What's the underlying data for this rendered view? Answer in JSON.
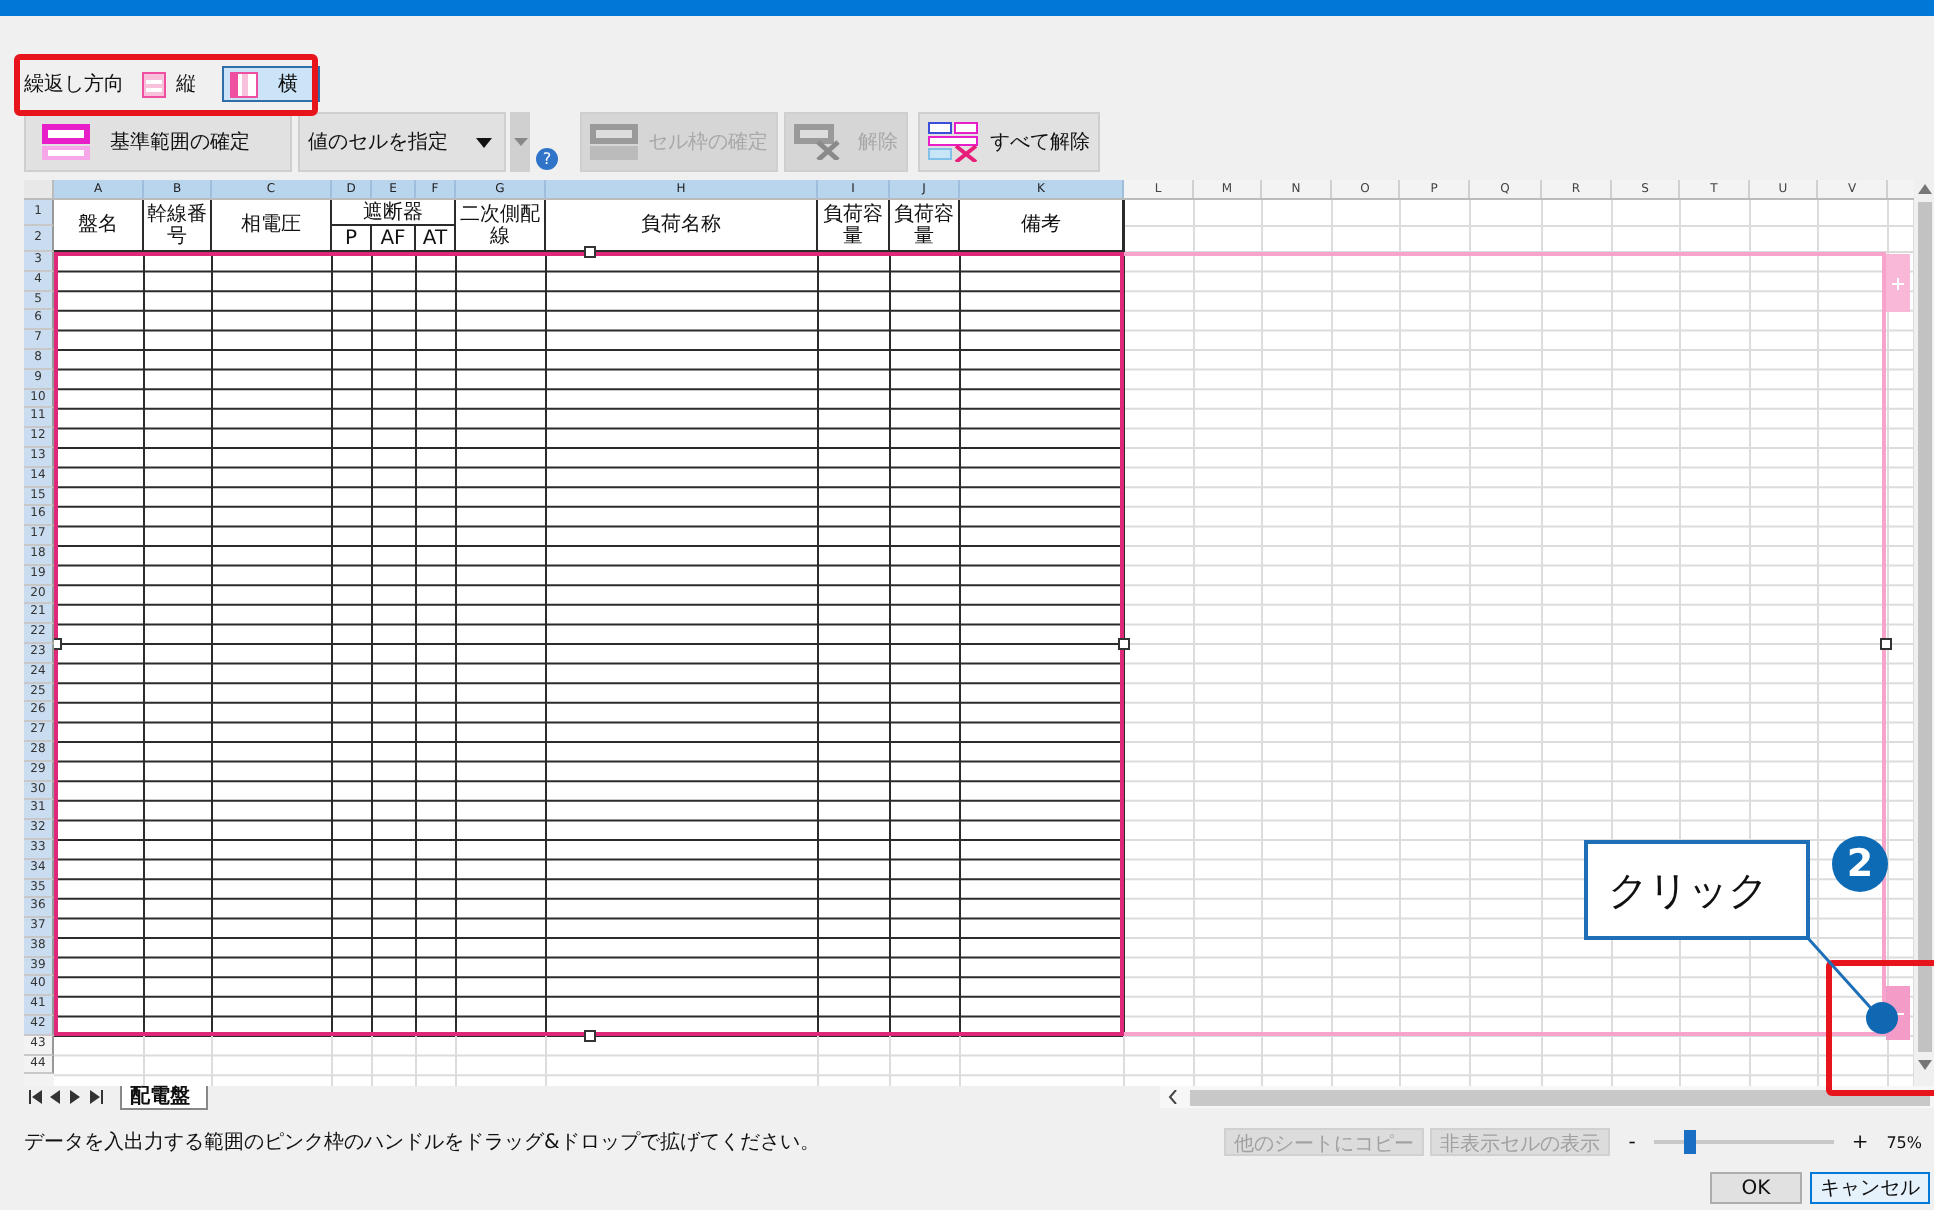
{
  "repeat_direction": {
    "label": "繰返し方向",
    "options": [
      {
        "kind": "vertical",
        "label": "縦",
        "selected": false
      },
      {
        "kind": "horizontal",
        "label": "横",
        "selected": true
      }
    ]
  },
  "toolbar": [
    {
      "kind": "range-confirm",
      "label": "基準範囲の確定",
      "disabled": false
    },
    {
      "kind": "dropdown",
      "value": "値のセルを指定"
    },
    {
      "kind": "help",
      "label": "?"
    },
    {
      "kind": "cell-confirm",
      "label": "セル枠の確定",
      "disabled": true
    },
    {
      "kind": "clear",
      "label": "解除",
      "disabled": true
    },
    {
      "kind": "clear-all",
      "label": "すべて解除",
      "disabled": false
    }
  ],
  "sheet": {
    "columns": [
      {
        "label": "A",
        "selected": true
      },
      {
        "label": "B",
        "selected": true
      },
      {
        "label": "C",
        "selected": true
      },
      {
        "label": "D",
        "selected": true
      },
      {
        "label": "E",
        "selected": true
      },
      {
        "label": "F",
        "selected": true
      },
      {
        "label": "G",
        "selected": true
      },
      {
        "label": "H",
        "selected": true
      },
      {
        "label": "I",
        "selected": true
      },
      {
        "label": "J",
        "selected": true
      },
      {
        "label": "K",
        "selected": true
      },
      {
        "label": "L",
        "selected": false
      },
      {
        "label": "M",
        "selected": false
      },
      {
        "label": "N",
        "selected": false
      },
      {
        "label": "O",
        "selected": false
      },
      {
        "label": "P",
        "selected": false
      },
      {
        "label": "Q",
        "selected": false
      },
      {
        "label": "R",
        "selected": false
      },
      {
        "label": "S",
        "selected": false
      },
      {
        "label": "T",
        "selected": false
      },
      {
        "label": "U",
        "selected": false
      },
      {
        "label": "V",
        "selected": false
      }
    ],
    "rows": [
      {
        "label": "1",
        "selected": true
      },
      {
        "label": "2",
        "selected": true
      },
      {
        "label": "3",
        "selected": true
      },
      {
        "label": "4",
        "selected": true
      },
      {
        "label": "5",
        "selected": true
      },
      {
        "label": "6",
        "selected": true
      },
      {
        "label": "7",
        "selected": true
      },
      {
        "label": "8",
        "selected": true
      },
      {
        "label": "9",
        "selected": true
      },
      {
        "label": "10",
        "selected": true
      },
      {
        "label": "11",
        "selected": true
      },
      {
        "label": "12",
        "selected": true
      },
      {
        "label": "13",
        "selected": true
      },
      {
        "label": "14",
        "selected": true
      },
      {
        "label": "15",
        "selected": true
      },
      {
        "label": "16",
        "selected": true
      },
      {
        "label": "17",
        "selected": true
      },
      {
        "label": "18",
        "selected": true
      },
      {
        "label": "19",
        "selected": true
      },
      {
        "label": "20",
        "selected": true
      },
      {
        "label": "21",
        "selected": true
      },
      {
        "label": "22",
        "selected": true
      },
      {
        "label": "23",
        "selected": true
      },
      {
        "label": "24",
        "selected": true
      },
      {
        "label": "25",
        "selected": true
      },
      {
        "label": "26",
        "selected": true
      },
      {
        "label": "27",
        "selected": true
      },
      {
        "label": "28",
        "selected": true
      },
      {
        "label": "29",
        "selected": true
      },
      {
        "label": "30",
        "selected": true
      },
      {
        "label": "31",
        "selected": true
      },
      {
        "label": "32",
        "selected": true
      },
      {
        "label": "33",
        "selected": true
      },
      {
        "label": "34",
        "selected": true
      },
      {
        "label": "35",
        "selected": true
      },
      {
        "label": "36",
        "selected": true
      },
      {
        "label": "37",
        "selected": true
      },
      {
        "label": "38",
        "selected": true
      },
      {
        "label": "39",
        "selected": true
      },
      {
        "label": "40",
        "selected": true
      },
      {
        "label": "41",
        "selected": true
      },
      {
        "label": "42",
        "selected": true
      },
      {
        "label": "43",
        "selected": false
      },
      {
        "label": "44",
        "selected": false
      }
    ],
    "header": [
      {
        "label": "盤名"
      },
      {
        "label": "幹線番号"
      },
      {
        "label": "相電圧"
      },
      {
        "label": "遮断器",
        "sub": [
          "P",
          "AF",
          "AT"
        ]
      },
      {
        "label": "二次側配線"
      },
      {
        "label": "負荷名称"
      },
      {
        "label": "負荷容量"
      },
      {
        "label": "負荷容量"
      },
      {
        "label": "備考"
      }
    ],
    "tabs": [
      {
        "label": "配電盤",
        "selected": true
      }
    ]
  },
  "status_bar": {
    "message": "データを入出力する範囲のピンク枠のハンドルをドラッグ&ドロップで拡げてください。",
    "buttons": [
      {
        "label": "他のシートにコピー",
        "disabled": true
      },
      {
        "label": "非表示セルの表示",
        "disabled": true
      }
    ],
    "zoom": {
      "minus": "-",
      "plus": "+",
      "level": 0.2,
      "reading": "75%"
    }
  },
  "dialog_buttons": [
    {
      "label": "OK",
      "selected": false
    },
    {
      "label": "キャンセル",
      "selected": true
    }
  ],
  "annotation": {
    "step": "2",
    "callout": "クリック"
  }
}
